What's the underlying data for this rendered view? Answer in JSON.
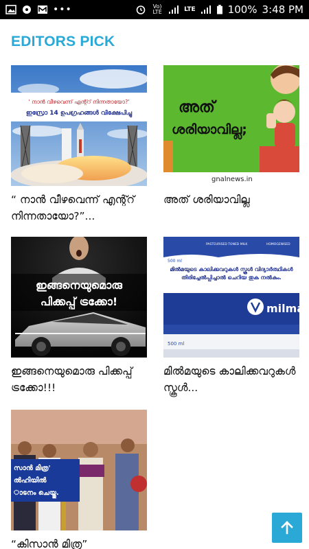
{
  "status_bar": {
    "network_label": "Vo) LTE",
    "lte_label": "LTE",
    "battery": "100%",
    "time": "3:48 PM",
    "more": "•••"
  },
  "section": {
    "title": "EDITORS PICK"
  },
  "cards": [
    {
      "title": "“ നാൻ വീഴവെന്ന് എന്റ്റ് നിന്നതായോ?”...",
      "image_caption_top": "' നാൻ വീഴവെന്ന് എന്റ്റ് നിന്നതായോ?'",
      "image_caption_bottom": "ഇസ്രോ 14 ഉപഗ്രഹങ്ങൾ വിക്ഷേപിച്ചു"
    },
    {
      "title": "അത് ശരിയാവില്ല",
      "image_text_1": "അത്",
      "image_text_2": "ശരിയാവില്ല;",
      "image_watermark": "gnalnews.in"
    },
    {
      "title": "ഇങ്ങനെയുമൊരു പിക്കപ്പ് ട്രക്കോ!!!",
      "image_text_1": "ഇങ്ങനെയുമൊരു",
      "image_text_2": "പിക്കപ്പ് ട്രക്കോ!"
    },
    {
      "title": "മിൽമയുടെ കാലിക്കവറുകൾ സ്കൂൾ...",
      "image_text": "മിൽമയുടെ കാലിക്കവറുകൾ സ്കൂൾ വിദ്യാർത്ഥികൾ തിരിച്ചേൽപ്പിച്ചാൽ ചെറിയ തുക നൽകും.",
      "brand": "milma",
      "pack_label": "500 ml",
      "pack_sub": "PASTEURISED TONED MILK",
      "pack_sub2": "HOMOGENISED"
    },
    {
      "title": "“കിസാൻ മിത്ര”",
      "image_text_1": "സാൻ മിത്ര'",
      "image_text_2": "ൽഹിയിൽ",
      "image_text_3": "ാടനം ചെയ്തു."
    }
  ],
  "colors": {
    "accent": "#2aa9d6",
    "status_bar": "#000000"
  }
}
